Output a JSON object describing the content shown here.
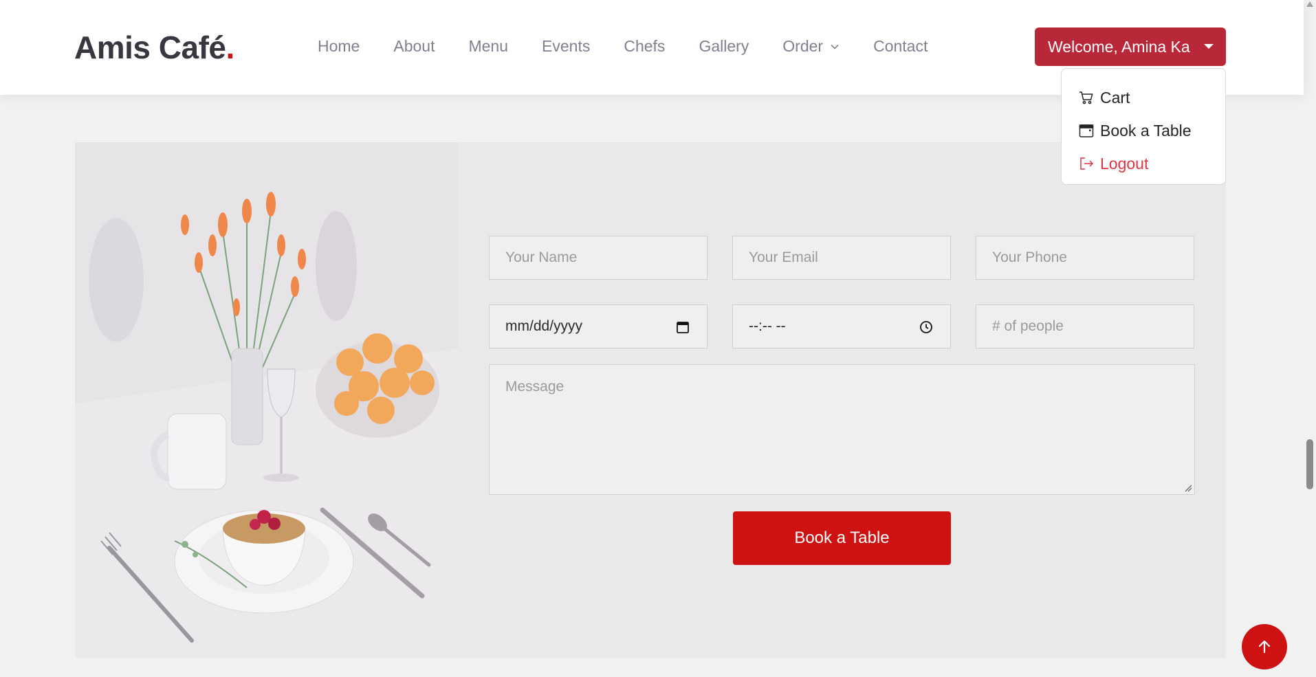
{
  "brand": {
    "name": "Amis Café",
    "dot": "."
  },
  "nav": {
    "items": [
      "Home",
      "About",
      "Menu",
      "Events",
      "Chefs",
      "Gallery",
      "Order",
      "Contact"
    ]
  },
  "user_menu": {
    "welcome_label": "Welcome, Amina Ka",
    "items": [
      {
        "label": "Cart",
        "icon": "cart-icon"
      },
      {
        "label": "Book a Table",
        "icon": "calendar-icon"
      },
      {
        "label": "Logout",
        "icon": "logout-icon"
      }
    ]
  },
  "form": {
    "name_placeholder": "Your Name",
    "email_placeholder": "Your Email",
    "phone_placeholder": "Your Phone",
    "date_value": "mm/dd/yyyy",
    "time_value": "--:-- --",
    "people_placeholder": "# of people",
    "message_placeholder": "Message",
    "submit_label": "Book a Table"
  },
  "colors": {
    "accent": "#ce1212",
    "welcome_button": "#b82838",
    "logout": "#dc3545"
  }
}
